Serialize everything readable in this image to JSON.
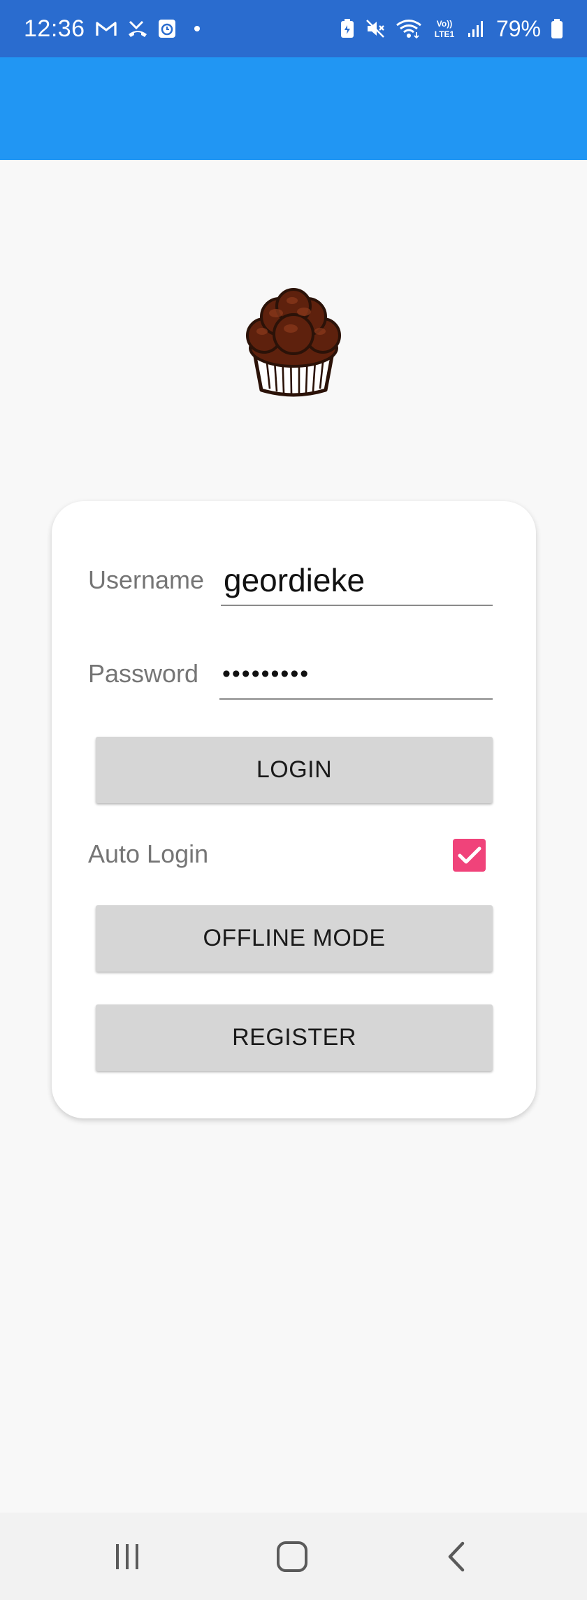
{
  "status_bar": {
    "time": "12:36",
    "battery": "79%",
    "left_icons": [
      "gmail-icon",
      "missed-call-icon",
      "clock-app-icon",
      "notification-dot"
    ],
    "right_icons": [
      "battery-saver-icon",
      "mute-icon",
      "wifi-icon",
      "volte-lte-icon",
      "signal-icon",
      "battery-icon"
    ],
    "network_label": "VoLTE1"
  },
  "colors": {
    "status_bar": "#2a6ccf",
    "app_bar": "#2196f3",
    "background": "#f8f8f8",
    "card": "#ffffff",
    "button": "#d6d6d6",
    "checkbox": "#f0437a"
  },
  "logo": {
    "icon": "cupcake-logo"
  },
  "login_form": {
    "username_label": "Username",
    "username_value": "geordieke",
    "password_label": "Password",
    "password_value": "•••••••••",
    "login_button": "LOGIN",
    "auto_login_label": "Auto Login",
    "auto_login_checked": true,
    "offline_button": "OFFLINE MODE",
    "register_button": "REGISTER"
  },
  "nav_bar": {
    "icons": [
      "recent-apps-icon",
      "home-icon",
      "back-icon"
    ]
  }
}
